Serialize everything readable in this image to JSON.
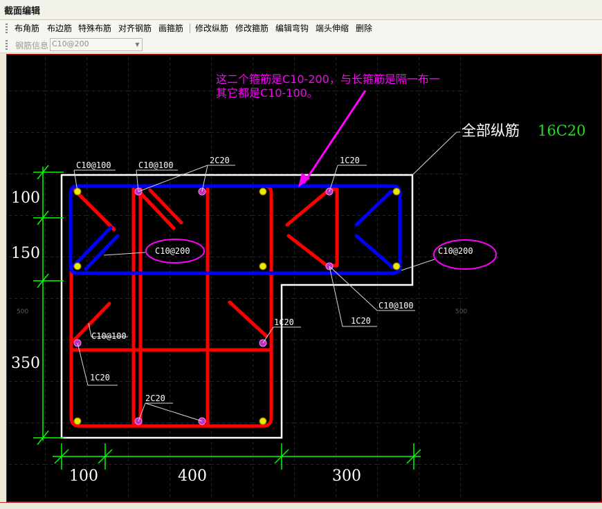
{
  "window": {
    "title": "截面编辑"
  },
  "toolbar": {
    "buttons": [
      "布角筋",
      "布边筋",
      "特殊布筋",
      "对齐钢筋",
      "画箍筋",
      "修改纵筋",
      "修改箍筋",
      "编辑弯钩",
      "端头伸缩",
      "删除"
    ]
  },
  "toolbar2": {
    "label": "钢筋信息",
    "value": "C10@200"
  },
  "drawing": {
    "annotation_line1": "这二个箍筋是C10-200，与长箍筋是隔一布一",
    "annotation_line2": "其它都是C10-100。",
    "total_label": "全部纵筋",
    "total_value": "16C20",
    "labels": {
      "c10_100_a": "C10@100",
      "c10_100_b": "C10@100",
      "two_c20_top": "2C20",
      "one_c20_top": "1C20",
      "c10_200_mid": "C10@200",
      "c10_200_right": "C10@200",
      "c10_100_right": "C10@100",
      "one_c20_right": "1C20",
      "one_c20_center": "1C20",
      "c10_100_left": "C10@100",
      "one_c20_left": "1C20",
      "two_c20_bottom": "2C20"
    },
    "grid_tick_left": "500",
    "grid_tick_right": "500",
    "dim_vertical": [
      "100",
      "150",
      "350"
    ],
    "dim_horizontal": [
      "100",
      "400",
      "300"
    ]
  },
  "colors": {
    "section_outline": "#ffffff",
    "stirrup_long": "#0000ff",
    "stirrup_other": "#ff0000",
    "annotation": "#ff00ff",
    "dimension": "#00ff00",
    "bar": "#ffff00"
  }
}
